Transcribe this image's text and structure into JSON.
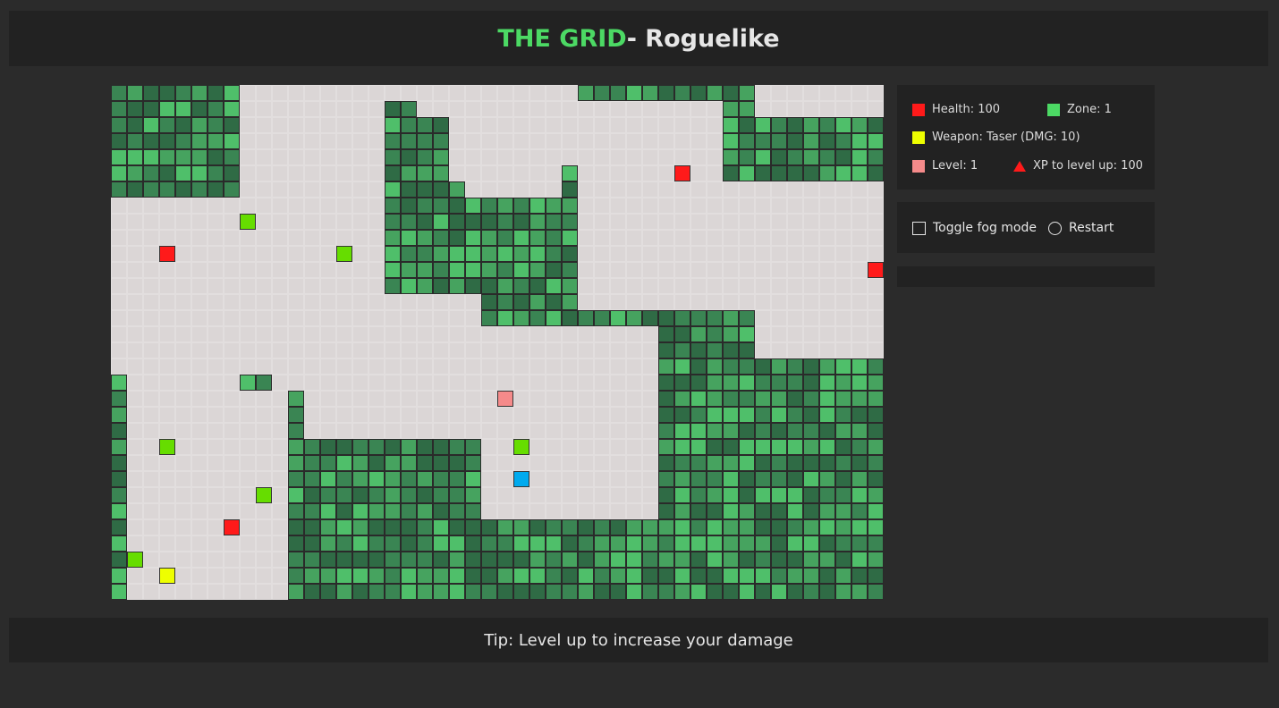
{
  "header": {
    "title_accent": "THE GRID",
    "title_rest": " - Roguelike"
  },
  "stats": {
    "health": "Health: 100",
    "zone": "Zone: 1",
    "weapon": "Weapon: Taser (DMG: 10)",
    "level": "Level: 1",
    "xp": "XP to level up: 100"
  },
  "controls": {
    "fog_label": "Toggle fog mode",
    "restart_label": "Restart"
  },
  "message": "",
  "footer": {
    "tip": "Tip: Level up to increase your damage"
  },
  "colors": {
    "wall_shades": [
      "#2f6b45",
      "#3a8553",
      "#46a35f",
      "#4fbf6a"
    ],
    "floor": "#dbd6d6",
    "health_item": "#ff1a1a",
    "zone_swatch": "#4cd964",
    "weapon_item": "#eeff00",
    "level_swatch": "#f58a8a",
    "enemy": "#66dd00",
    "player": "#00aaee",
    "xp_icon": "#ff1a1a"
  },
  "map": {
    "cols": 48,
    "rows": 32,
    "floor_rects": [
      [
        8,
        0,
        20,
        1
      ],
      [
        0,
        7,
        14,
        17
      ],
      [
        8,
        1,
        16,
        12
      ],
      [
        8,
        2,
        15,
        12
      ],
      [
        11,
        12,
        12,
        12
      ],
      [
        21,
        0,
        28,
        6
      ],
      [
        29,
        1,
        37,
        13
      ],
      [
        40,
        0,
        47,
        1
      ],
      [
        29,
        6,
        39,
        13
      ],
      [
        40,
        6,
        47,
        16
      ],
      [
        12,
        13,
        22,
        21
      ],
      [
        23,
        15,
        33,
        26
      ],
      [
        1,
        19,
        10,
        31
      ],
      [
        0,
        18,
        7,
        18
      ],
      [
        10,
        18,
        11,
        18
      ]
    ],
    "wall_cells": [
      [
        21,
        6
      ],
      [
        28,
        5
      ],
      [
        28,
        6
      ],
      [
        0,
        18
      ],
      [
        8,
        18
      ],
      [
        9,
        18
      ],
      [
        17,
        1
      ],
      [
        18,
        1
      ],
      [
        19,
        2
      ]
    ],
    "entities": [
      {
        "type": "health",
        "col": 35,
        "row": 5
      },
      {
        "type": "health",
        "col": 3,
        "row": 10
      },
      {
        "type": "health",
        "col": 47,
        "row": 11
      },
      {
        "type": "health",
        "col": 7,
        "row": 27
      },
      {
        "type": "enemy",
        "col": 8,
        "row": 8
      },
      {
        "type": "enemy",
        "col": 14,
        "row": 10
      },
      {
        "type": "enemy",
        "col": 3,
        "row": 22
      },
      {
        "type": "enemy",
        "col": 9,
        "row": 25
      },
      {
        "type": "enemy",
        "col": 1,
        "row": 29
      },
      {
        "type": "enemy",
        "col": 25,
        "row": 22
      },
      {
        "type": "weapon",
        "col": 3,
        "row": 30
      },
      {
        "type": "level",
        "col": 24,
        "row": 19
      },
      {
        "type": "player",
        "col": 25,
        "row": 24
      }
    ]
  }
}
